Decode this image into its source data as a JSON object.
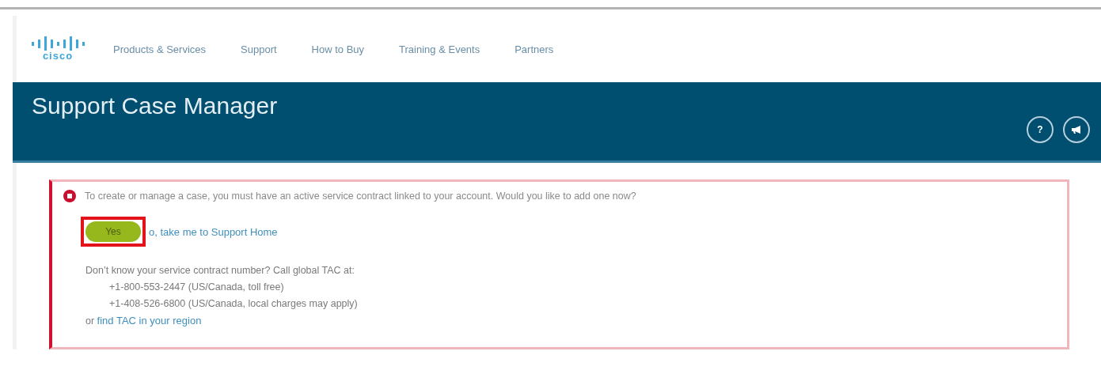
{
  "logo": {
    "text": "cisco"
  },
  "nav": [
    {
      "label": "Products & Services"
    },
    {
      "label": "Support"
    },
    {
      "label": "How to Buy"
    },
    {
      "label": "Training & Events"
    },
    {
      "label": "Partners"
    }
  ],
  "banner": {
    "title": "Support Case Manager",
    "help_button": "?"
  },
  "alert": {
    "message": "To create or manage a case, you must have an active service contract linked to your account. Would you like to add one now?",
    "yes_button": "Yes",
    "no_link": "o, take me to Support Home",
    "highlighted": true,
    "help_text": "Don’t know your service contract number? Call global TAC at:",
    "phones": [
      "+1-800-553-2447 (US/Canada, toll free)",
      "+1-408-526-6800 (US/Canada, local charges may apply)"
    ],
    "region_prefix": "or",
    "region_link": "find TAC in your region"
  }
}
